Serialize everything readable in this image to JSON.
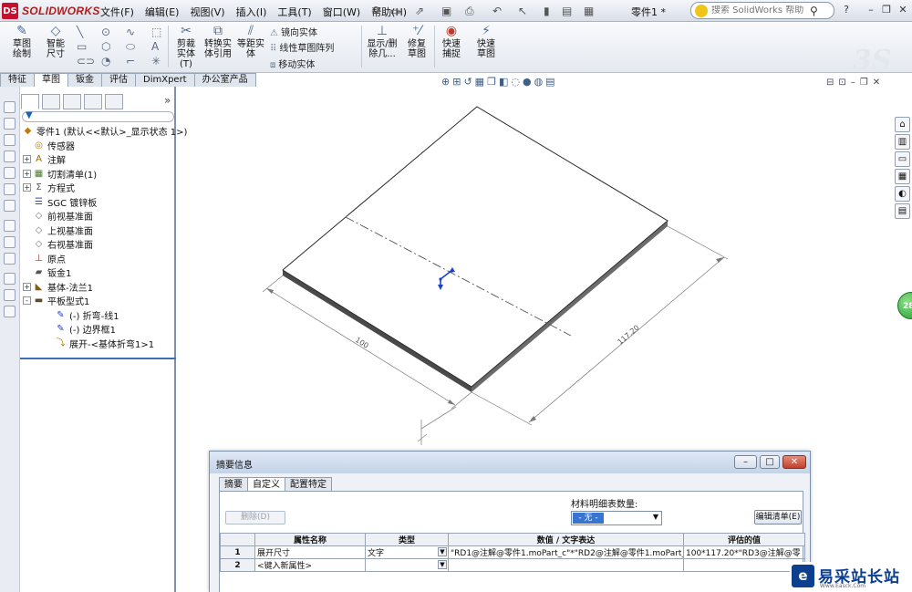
{
  "app": {
    "brand": "SOLIDWORKS",
    "brand_mark": "DS",
    "doc_title": "零件1 *"
  },
  "menu": [
    "文件(F)",
    "编辑(E)",
    "视图(V)",
    "插入(I)",
    "工具(T)",
    "窗口(W)",
    "帮助(H)"
  ],
  "help_search": {
    "placeholder": "搜索 SolidWorks 帮助"
  },
  "commands": {
    "sketch": "草图绘制",
    "smart_dim": "智能尺寸",
    "trim": "剪裁实体(T)",
    "convert": "转换实体引用",
    "offset": "等距实体",
    "mirror": "镜向实体",
    "linear_pattern": "线性草图阵列",
    "move": "移动实体",
    "show_delete": "显示/删除几...",
    "repair": "修复草图",
    "quick_snap": "快速捕捉",
    "rapid_sketch": "快速草图"
  },
  "cmd_tabs": [
    "特征",
    "草图",
    "钣金",
    "评估",
    "DimXpert",
    "办公室产品"
  ],
  "active_cmd_tab": "草图",
  "tree": [
    {
      "label": "零件1 (默认<<默认>_显示状态 1>)",
      "icon": "part-icon",
      "indent": 0,
      "expand": ""
    },
    {
      "label": "传感器",
      "icon": "sensor-icon",
      "indent": 1,
      "expand": ""
    },
    {
      "label": "注解",
      "icon": "annotation-icon",
      "indent": 1,
      "expand": "+"
    },
    {
      "label": "切割清单(1)",
      "icon": "cut-list-icon",
      "indent": 1,
      "expand": "+"
    },
    {
      "label": "方程式",
      "icon": "equation-icon",
      "indent": 1,
      "expand": "+"
    },
    {
      "label": "SGC 镀锌板",
      "icon": "material-icon",
      "indent": 1,
      "expand": ""
    },
    {
      "label": "前视基准面",
      "icon": "plane-icon",
      "indent": 1,
      "expand": ""
    },
    {
      "label": "上视基准面",
      "icon": "plane-icon",
      "indent": 1,
      "expand": ""
    },
    {
      "label": "右视基准面",
      "icon": "plane-icon",
      "indent": 1,
      "expand": ""
    },
    {
      "label": "原点",
      "icon": "origin-icon",
      "indent": 1,
      "expand": ""
    },
    {
      "label": "钣金1",
      "icon": "sheetmetal-icon",
      "indent": 1,
      "expand": ""
    },
    {
      "label": "基体-法兰1",
      "icon": "base-flange-icon",
      "indent": 1,
      "expand": "+"
    },
    {
      "label": "平板型式1",
      "icon": "flat-pattern-icon",
      "indent": 1,
      "expand": "-"
    },
    {
      "label": "(-) 折弯-线1",
      "icon": "sketch-icon",
      "indent": 2,
      "expand": ""
    },
    {
      "label": "(-) 边界框1",
      "icon": "sketch-icon",
      "indent": 2,
      "expand": ""
    },
    {
      "label": "展开-<基体折弯1>1",
      "icon": "unfold-icon",
      "indent": 2,
      "expand": ""
    }
  ],
  "model": {
    "dim_width": "100",
    "dim_length": "117.20"
  },
  "dialog": {
    "title": "摘要信息",
    "tabs": [
      "摘要",
      "自定义",
      "配置特定"
    ],
    "active_tab": "自定义",
    "delete_btn": "删除(D)",
    "bom_label": "材料明细表数量:",
    "bom_value": "- 无 -",
    "edit_list_btn": "编辑清单(E)",
    "columns": [
      "",
      "属性名称",
      "类型",
      "数值 / 文字表达",
      "评估的值"
    ],
    "rows": [
      {
        "num": "1",
        "name": "展开尺寸",
        "type": "文字",
        "value": "\"RD1@注解@零件1.moPart_c\"*\"RD2@注解@零件1.moPart_c\"",
        "evaluated": "100*117.20*\"RD3@注解@零"
      },
      {
        "num": "2",
        "name": "<键入新属性>",
        "type": "",
        "value": "",
        "evaluated": ""
      }
    ]
  },
  "watermark": {
    "logo": "e",
    "cn": "易采站长站",
    "en": "Www.Easck.Com"
  },
  "colors": {
    "accent": "#3874d0",
    "close": "#c0402a",
    "brand": "#c8102e",
    "origin": "#1b3fd0"
  }
}
